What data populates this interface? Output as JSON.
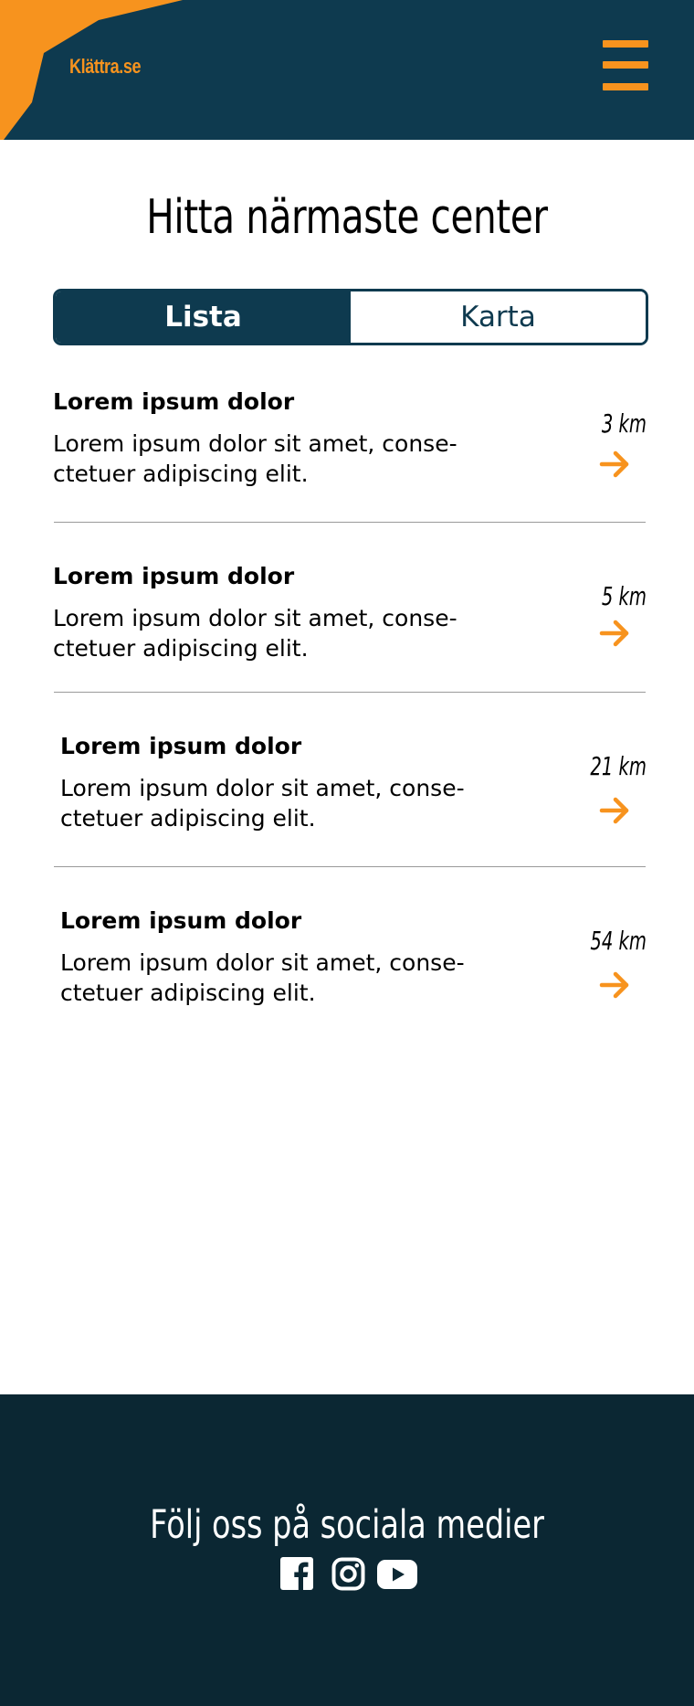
{
  "header": {
    "logo": "Klättra.se",
    "menu_icon": "hamburger-menu-icon",
    "brand_color": "#f7931e",
    "background_color": "#0e3a4f"
  },
  "main": {
    "title": "Hitta närmaste center",
    "tabs": [
      {
        "label": "Lista",
        "active": true
      },
      {
        "label": "Karta",
        "active": false
      }
    ],
    "items": [
      {
        "title": "Lorem ipsum dolor",
        "description": "Lorem ipsum dolor sit amet, conse-ctetuer adipiscing elit.",
        "desc_line1": "Lorem ipsum dolor sit amet, conse-",
        "desc_line2": "ctetuer adipiscing elit.",
        "distance": "3 km",
        "icon": "arrow-right-icon"
      },
      {
        "title": "Lorem ipsum dolor",
        "description": "Lorem ipsum dolor sit amet, conse-ctetuer adipiscing elit.",
        "desc_line1": "Lorem ipsum dolor sit amet, conse-",
        "desc_line2": "ctetuer adipiscing elit.",
        "distance": "5 km",
        "icon": "arrow-right-icon"
      },
      {
        "title": "Lorem ipsum dolor",
        "description": "Lorem ipsum dolor sit amet, conse-ctetuer adipiscing elit.",
        "desc_line1": "Lorem ipsum dolor sit amet, conse-",
        "desc_line2": "ctetuer adipiscing elit.",
        "distance": "21 km",
        "icon": "arrow-right-icon"
      },
      {
        "title": "Lorem ipsum dolor",
        "description": "Lorem ipsum dolor sit amet, conse-ctetuer adipiscing elit.",
        "desc_line1": "Lorem ipsum dolor sit amet, conse-",
        "desc_line2": "ctetuer adipiscing elit.",
        "distance": "54 km",
        "icon": "arrow-right-icon"
      }
    ]
  },
  "footer": {
    "title": "Följ oss på sociala medier",
    "social_icons": [
      "facebook-icon",
      "instagram-icon",
      "youtube-icon"
    ],
    "background_color": "#0b2733"
  }
}
